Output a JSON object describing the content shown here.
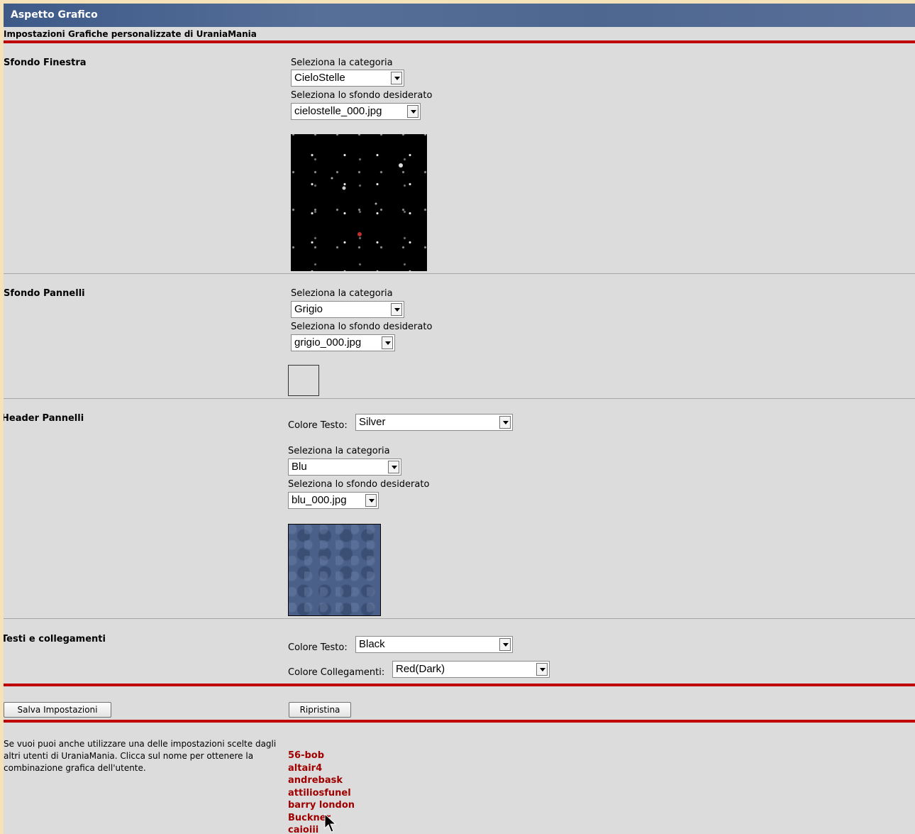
{
  "header": {
    "title": "Aspetto Grafico"
  },
  "subtitle": "Impostazioni Grafiche personalizzate di UraniaMania",
  "sfondo_finestra": {
    "title": "Sfondo Finestra",
    "category_label": "Seleziona la categoria",
    "category_value": "CieloStelle",
    "background_label": "Seleziona lo sfondo desiderato",
    "background_value": "cielostelle_000.jpg"
  },
  "sfondo_pannelli": {
    "title": "Sfondo Pannelli",
    "category_label": "Seleziona la categoria",
    "category_value": "Grigio",
    "background_label": "Seleziona lo sfondo desiderato",
    "background_value": "grigio_000.jpg"
  },
  "header_pannelli": {
    "title": "Header Pannelli",
    "text_color_label": "Colore Testo:",
    "text_color_value": "Silver",
    "category_label": "Seleziona la categoria",
    "category_value": "Blu",
    "background_label": "Seleziona lo sfondo desiderato",
    "background_value": "blu_000.jpg"
  },
  "testi_collegamenti": {
    "title": "Testi e collegamenti",
    "text_color_label": "Colore Testo:",
    "text_color_value": "Black",
    "link_color_label": "Colore Collegamenti:",
    "link_color_value": "Red(Dark)"
  },
  "buttons": {
    "save_label": "Salva Impostazioni",
    "reset_label": "Ripristina"
  },
  "info_text": "Se vuoi puoi anche utilizzare una delle impostazioni scelte dagli altri utenti di UraniaMania. Clicca sul nome per ottenere la combinazione grafica dell'utente.",
  "users": [
    "56-bob",
    "altair4",
    "andrebask",
    "attiliosfunel",
    "barry london",
    "Buckner",
    "caioiii"
  ],
  "colors": {
    "accent_red": "#c00000",
    "link_red": "#a00000",
    "header_blue": "#4d6790"
  }
}
